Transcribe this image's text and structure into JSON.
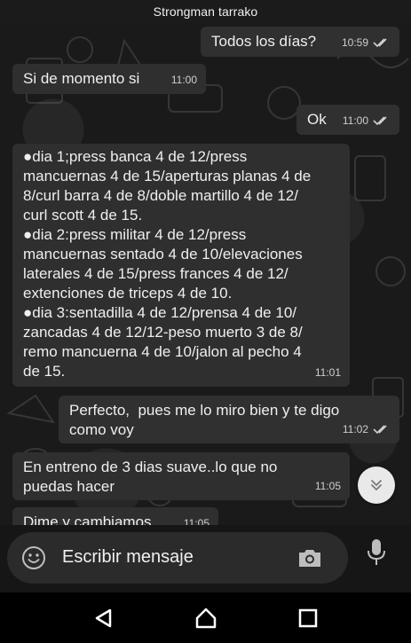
{
  "header": {
    "title": "Strongman tarrako"
  },
  "messages": [
    {
      "direction": "out",
      "text": "Todos los días?",
      "time": "10:59",
      "read": true
    },
    {
      "direction": "in",
      "text": "Si de momento si",
      "time": "11:00"
    },
    {
      "direction": "out",
      "text": "Ok",
      "time": "11:00",
      "read": true
    },
    {
      "direction": "in",
      "text": "●dia 1;press banca 4 de 12/press\nmancuernas 4 de 15/aperturas planas 4 de\n8/curl barra 4 de 8/doble martillo 4 de 12/\ncurl scott 4 de 15.\n●dia 2:press militar 4 de 12/press\nmancuernas sentado 4 de 10/elevaciones\nlaterales 4 de 15/press frances 4 de 12/\nextenciones de triceps 4 de 10.\n●dia 3:sentadilla 4 de 12/prensa 4 de 10/\nzancadas 4 de 12/12-peso muerto 3 de 8/\nremo mancuerna 4 de 10/jalon al pecho 4\nde 15.",
      "time": "11:01"
    },
    {
      "direction": "out",
      "text": "Perfecto,  pues me lo miro bien y te digo\ncomo voy",
      "time": "11:02",
      "read": true
    },
    {
      "direction": "in",
      "text": "En entreno de 3 dias suave..lo que no\npuedas hacer",
      "time": "11:05"
    },
    {
      "direction": "in",
      "text": "Dime y cambiamos",
      "time": "11:05"
    }
  ],
  "composer": {
    "placeholder": "Escribir mensaje"
  },
  "icons": {
    "emoji": "emoji-icon",
    "camera": "camera-icon",
    "mic": "microphone-icon",
    "scroll": "chevron-double-down-icon",
    "back": "nav-back-icon",
    "home": "nav-home-icon",
    "recents": "nav-recents-icon"
  },
  "colors": {
    "bubble": "#2f2f2f",
    "background": "#1a1a1a",
    "accent": "#e9e9e9"
  }
}
